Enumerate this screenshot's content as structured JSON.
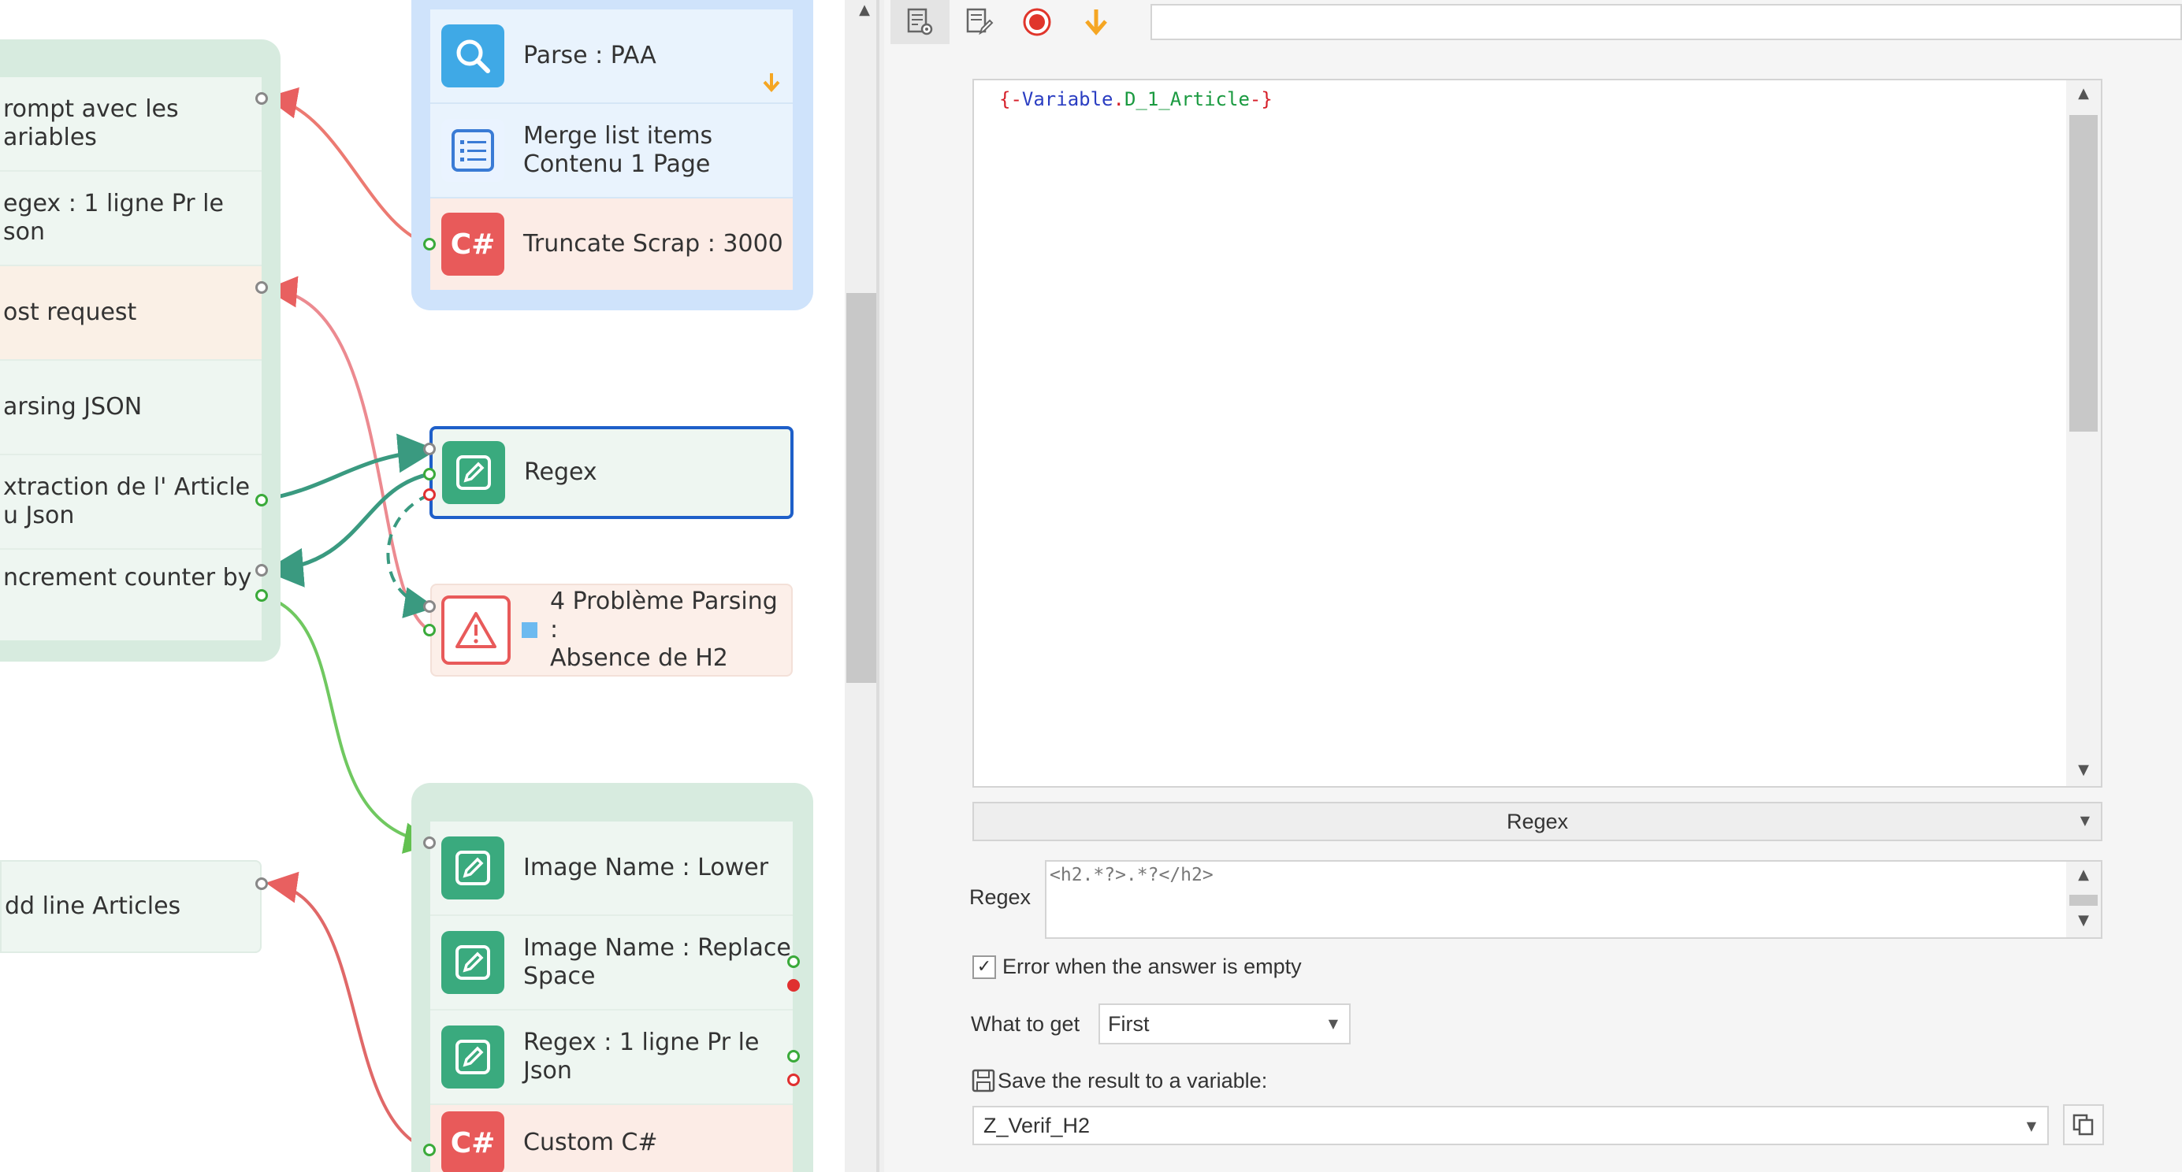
{
  "canvas": {
    "left_group": {
      "items": [
        {
          "label": "rompt avec les\nariables"
        },
        {
          "label": "egex : 1 ligne Pr le\nson"
        },
        {
          "label": "ost request"
        },
        {
          "label": "arsing JSON"
        },
        {
          "label": "xtraction de l' Article\nu Json"
        },
        {
          "label": "ncrement counter by"
        }
      ]
    },
    "add_line_node": {
      "label": "dd line Articles"
    },
    "top_right_group": {
      "items": [
        {
          "label": "Parse : PAA",
          "icon": "search-icon"
        },
        {
          "label": "Merge list items\nContenu 1 Page",
          "icon": "list-icon"
        },
        {
          "label": "Truncate Scrap : 3000",
          "icon": "csharp-icon",
          "icon_text": "C#"
        }
      ]
    },
    "regex_node": {
      "label": "Regex",
      "icon": "pencil-icon"
    },
    "problem_node": {
      "label": "4 Problème Parsing :\nAbsence de H2",
      "icon": "warning-icon"
    },
    "bottom_group": {
      "items": [
        {
          "label": "Image Name : Lower",
          "icon": "pencil-icon"
        },
        {
          "label": "Image Name : Replace\nSpace",
          "icon": "pencil-icon"
        },
        {
          "label": "Regex : 1 ligne Pr le\nJson",
          "icon": "pencil-icon"
        },
        {
          "label": "Custom C#",
          "icon": "csharp-icon",
          "icon_text": "C#"
        }
      ]
    }
  },
  "panel": {
    "toolbar": {
      "icons": [
        "settings-doc-icon",
        "edit-doc-icon",
        "record-icon",
        "arrow-down-icon"
      ],
      "search_value": ""
    },
    "input_text": {
      "open": "{-",
      "var_word": "Variable",
      "dot1": ".",
      "name": "D_1_Article",
      "close": "-}"
    },
    "action_dropdown": {
      "value": "Regex"
    },
    "regex_label": "Regex",
    "regex_value": "<h2.*?>.*?</h2>",
    "error_checkbox": {
      "checked": true,
      "label": "Error  when the answer is empty"
    },
    "what_to_get": {
      "label": "What to get",
      "value": "First"
    },
    "save_result": {
      "label": "Save the result to a variable:",
      "value": "Z_Verif_H2"
    }
  },
  "colors": {
    "teal": "#3aaa7e",
    "blue_icon": "#3fa9e6",
    "red_icon": "#e85a5a",
    "selected_border": "#1e5fc9",
    "orange_arrow": "#f5a623"
  }
}
